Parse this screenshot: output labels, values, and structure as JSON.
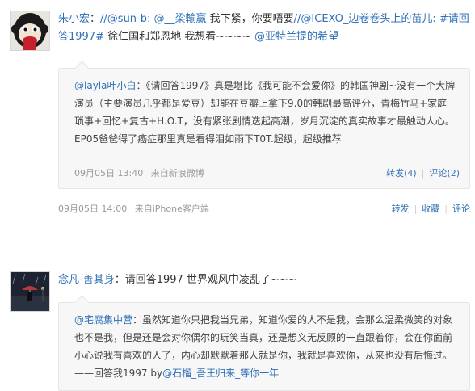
{
  "post1": {
    "author": "朱小宏",
    "colon": "：",
    "mention_sunb": "//@sun-b:",
    "mention_liang": "@__梁輸赢",
    "text_a": " 我下紧，你要唔要",
    "mention_icexo": "//@ICEXO_边卷卷头上的苗儿:",
    "hashtag": "#请回答1997#",
    "text_b": " 徐仁国和郑恩地 我想看~~~~ ",
    "mention_hope": "@亚特兰提的希望",
    "quote": {
      "author": "@layla叶小白",
      "text": "：《请回答1997》真是堪比《我可能不会爱你》的韩国神剧~没有一个大牌演员（主要演员几乎都是爱豆）却能在豆瓣上拿下9.0的韩剧最高评分，青梅竹马+家庭琐事+回忆+复古+H.O.T，没有紧张剧情迭起高潮，岁月沉淀的真实故事才最触动人心。EP05爸爸得了癌症那里真是看得泪如雨下T0T.超级，超级推荐",
      "time": "09月05日 13:40",
      "from_prefix": "来自",
      "source": "新浪微博",
      "repost": "转发(4)",
      "comment": "评论(2)"
    },
    "time": "09月05日 14:00",
    "from_prefix": "来自",
    "source": "iPhone客户端",
    "actions": [
      "转发",
      "收藏",
      "评论"
    ]
  },
  "post2": {
    "author": "念凡-善其身",
    "colon": "：",
    "text": "请回答1997 世界观风中凌乱了~~~",
    "quote": {
      "author": "@宅腐集中营",
      "text_a": "：虽然知道你只把我当兄弟，知道你爱的人不是我，会那么温柔微笑的对象也不是我，但是还是会对你偶尔的玩笑当真，还是想义无反顾的一直跟着你，会在你面前小心说我有喜欢的人了，内心却默默着那人就是你，我就是喜欢你，从来也没有后悔过。——回答我1997 by",
      "mention": "@石榴_吾王归来_等你一年"
    }
  },
  "colors": {
    "link": "#2f6fb7",
    "meta": "#999999",
    "quote_bg": "#f7f7f7"
  },
  "icons": [
    "monkey-avatar",
    "rainy-street-avatar"
  ]
}
